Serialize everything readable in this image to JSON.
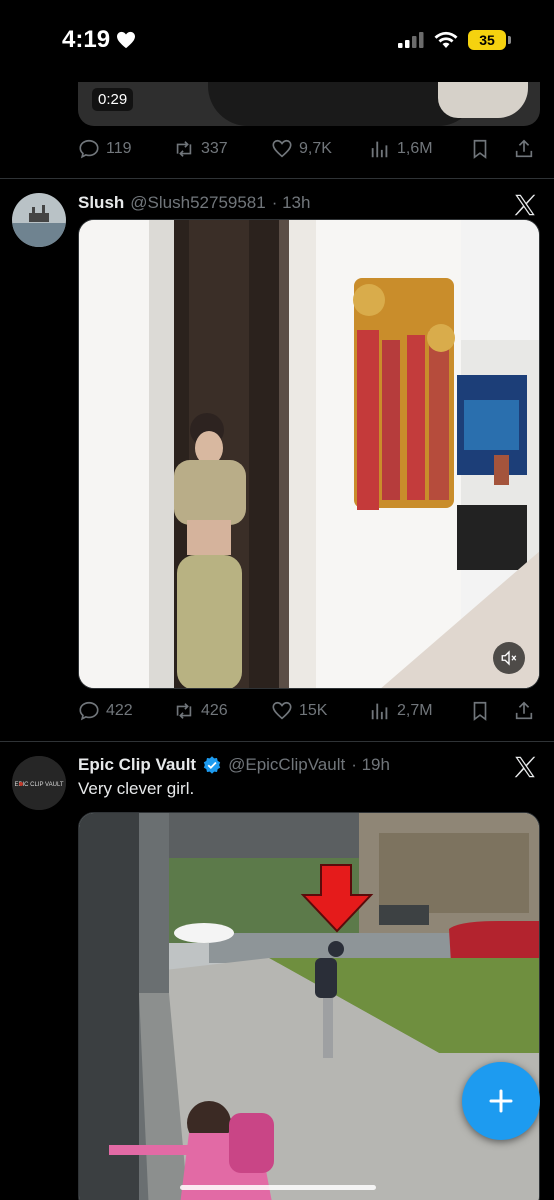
{
  "status_bar": {
    "time": "4:19",
    "battery": "35",
    "icons": [
      "heart-icon",
      "signal-icon",
      "wifi-icon",
      "battery-icon"
    ]
  },
  "tweet_top": {
    "duration": "0:29",
    "actions": {
      "replies": "119",
      "reposts": "337",
      "likes": "9,7K",
      "views": "1,6M"
    }
  },
  "tweet_slush": {
    "name": "Slush",
    "handle": "@Slush52759581",
    "time": "· 13h",
    "actions": {
      "replies": "422",
      "reposts": "426",
      "likes": "15K",
      "views": "2,7M"
    }
  },
  "tweet_epic": {
    "name": "Epic Clip Vault",
    "handle": "@EpicClipVault",
    "time": "· 19h",
    "text": "Very clever girl.",
    "avatar_text": "EPIC CLIP VAULT"
  },
  "colors": {
    "accent": "#1d9bf0",
    "muted": "#71767b",
    "background": "#000000",
    "verified": "#1d9bf0"
  }
}
